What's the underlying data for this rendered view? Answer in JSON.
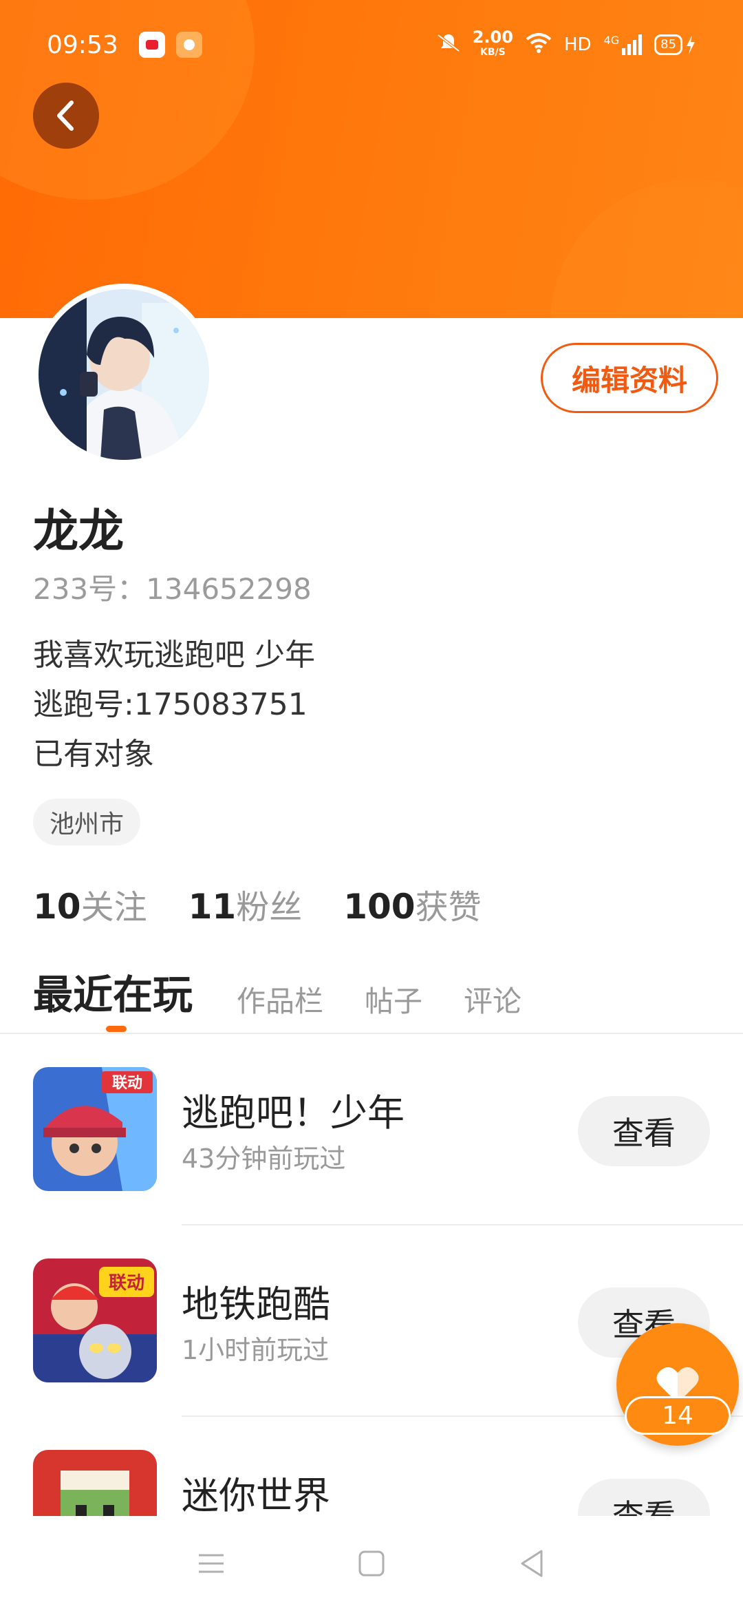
{
  "status_bar": {
    "time": "09:53",
    "net_speed_value": "2.00",
    "net_speed_unit": "KB/S",
    "hd": "HD",
    "network": "4G",
    "battery": "85"
  },
  "profile": {
    "edit_label": "编辑资料",
    "username": "龙龙",
    "uid_text": "233号：134652298",
    "bio_lines": [
      "我喜欢玩逃跑吧 少年",
      "逃跑号:175083751",
      "已有对象"
    ],
    "location": "池州市",
    "stats": [
      {
        "num": "10",
        "label": "关注"
      },
      {
        "num": "11",
        "label": "粉丝"
      },
      {
        "num": "100",
        "label": "获赞"
      }
    ]
  },
  "tabs": [
    "最近在玩",
    "作品栏",
    "帖子",
    "评论"
  ],
  "games": [
    {
      "name": "逃跑吧！少年",
      "time": "43分钟前玩过",
      "view": "查看",
      "icon": "game-icon-escape",
      "badge": "联动"
    },
    {
      "name": "地铁跑酷",
      "time": "1小时前玩过",
      "view": "查看",
      "icon": "game-icon-subway",
      "badge": "联动"
    },
    {
      "name": "迷你世界",
      "time": "",
      "view": "查看",
      "icon": "game-icon-mini-world"
    }
  ],
  "like": {
    "count": "14"
  },
  "colors": {
    "accent": "#ff6a06",
    "edit_border": "#f25a12",
    "fab": "#ff8a12"
  }
}
